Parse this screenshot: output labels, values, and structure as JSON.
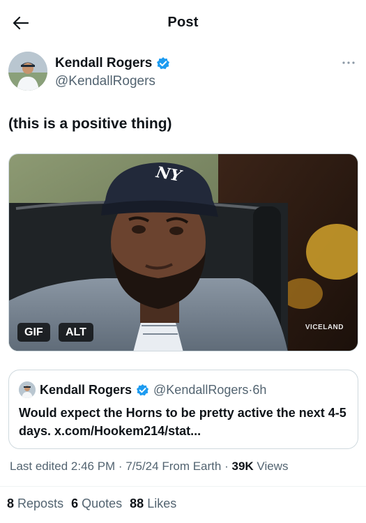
{
  "header": {
    "title": "Post",
    "back_icon": "arrow-left-icon"
  },
  "author": {
    "display_name": "Kendall Rogers",
    "handle": "@KendallRogers",
    "verified": true,
    "verified_color": "#1d9bf0",
    "more_icon": "more-horizontal-icon"
  },
  "post": {
    "text": "(this is a positive thing)",
    "media": {
      "gif_label": "GIF",
      "alt_label": "ALT",
      "watermark": "VICELAND",
      "cap_logo": "NY"
    }
  },
  "quote": {
    "display_name": "Kendall Rogers",
    "handle": "@KendallRogers",
    "separator": "·",
    "time": "6h",
    "text": "Would expect the Horns to be pretty active the next 4-5 days. x.com/Hookem214/stat..."
  },
  "meta": {
    "edited": "Last edited 2:46 PM · 7/5/24",
    "location": "From Earth",
    "separator": "·",
    "views_count": "39K",
    "views_label": "Views"
  },
  "stats": {
    "reposts_count": "8",
    "reposts_label": "Reposts",
    "quotes_count": "6",
    "quotes_label": "Quotes",
    "likes_count": "88",
    "likes_label": "Likes"
  }
}
